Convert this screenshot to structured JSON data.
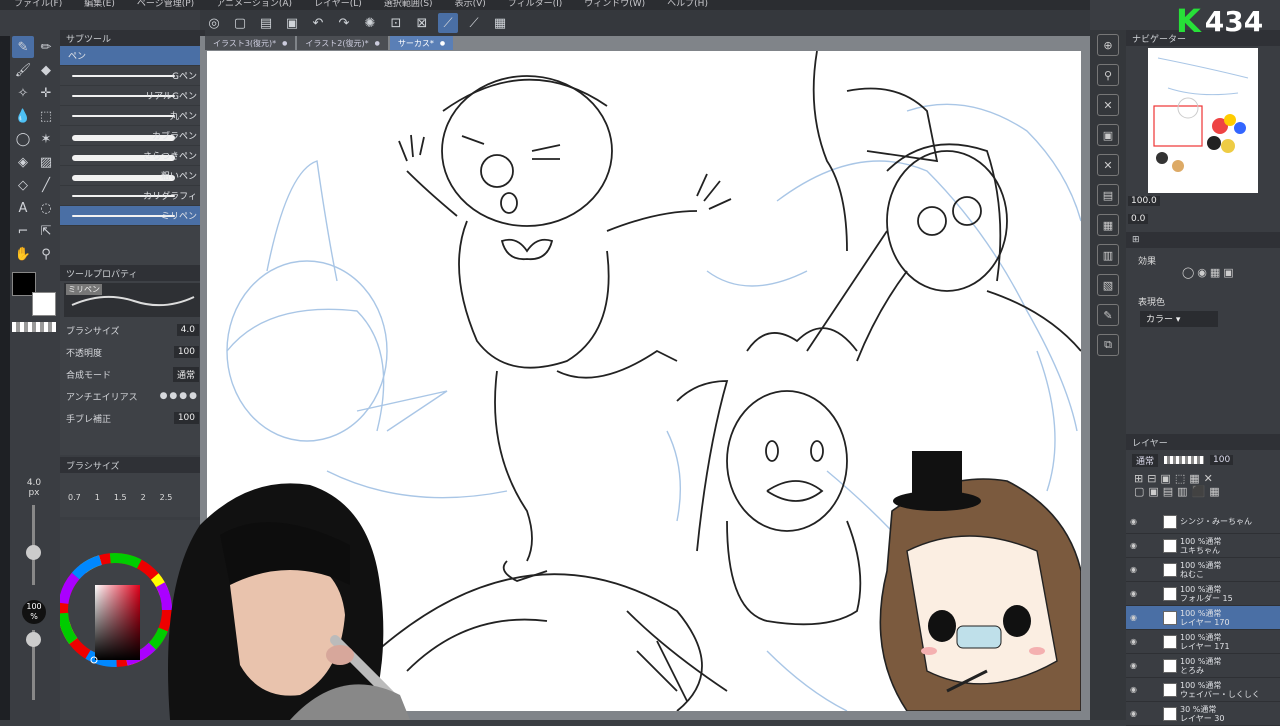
{
  "menu": [
    "ファイル(F)",
    "編集(E)",
    "ページ管理(P)",
    "アニメーション(A)",
    "レイヤー(L)",
    "選択範囲(S)",
    "表示(V)",
    "フィルター(I)",
    "ウィンドウ(W)",
    "ヘルプ(H)"
  ],
  "tabs": [
    {
      "label": "イラスト3(復元)*"
    },
    {
      "label": "イラスト2(復元)*"
    },
    {
      "label": "サーカス*"
    }
  ],
  "subtool": {
    "title": "サブツール",
    "group": "ペン",
    "brushes": [
      "Gペン",
      "リアルGペン",
      "丸ペン",
      "カブラペン",
      "さらつきペン",
      "粗いペン",
      "カリグラフィ",
      "ミリペン"
    ]
  },
  "toolprop": {
    "title": "ツールプロパティ",
    "preset": "ミリペン",
    "brush_size_label": "ブラシサイズ",
    "brush_size": "4.0",
    "opacity_label": "不透明度",
    "opacity": "100",
    "blend_label": "合成モード",
    "blend": "通常",
    "aa_label": "アンチエイリアス",
    "stabilize_label": "手ブレ補正",
    "stabilize": "100"
  },
  "brushsize_panel": {
    "title": "ブラシサイズ",
    "values": [
      "0.7",
      "1",
      "1.5",
      "2",
      "2.5"
    ]
  },
  "side": {
    "size": "4.0",
    "size_unit": "px",
    "opacity": "100",
    "opacity_unit": "%"
  },
  "navigator": {
    "title": "ナビゲーター",
    "zoom": "100.0",
    "angle": "0.0"
  },
  "effects": {
    "title": "効果",
    "color_label": "表現色",
    "color_mode": "カラー"
  },
  "layers": {
    "title": "レイヤー",
    "blend": "通常",
    "opacity": "100",
    "items": [
      {
        "pct": "",
        "name": "シンジ・みーちゃん",
        "sel": false
      },
      {
        "pct": "100 %通常",
        "name": "ユキちゃん",
        "sel": false
      },
      {
        "pct": "100 %通常",
        "name": "ねむこ",
        "sel": false
      },
      {
        "pct": "100 %通常",
        "name": "フォルダー 15",
        "sel": false
      },
      {
        "pct": "100 %通常",
        "name": "レイヤー 170",
        "sel": true
      },
      {
        "pct": "100 %通常",
        "name": "レイヤー 171",
        "sel": false
      },
      {
        "pct": "100 %通常",
        "name": "とろみ",
        "sel": false
      },
      {
        "pct": "100 %通常",
        "name": "ウェイバー・しくしく",
        "sel": false
      },
      {
        "pct": "30 %通常",
        "name": "レイヤー 30",
        "sel": false
      }
    ]
  },
  "logo": {
    "letter": "K",
    "number": "434"
  },
  "colors": {
    "accent": "#4a6fa5",
    "sketch": "#a9c6e6",
    "logo_green": "#27e038"
  }
}
